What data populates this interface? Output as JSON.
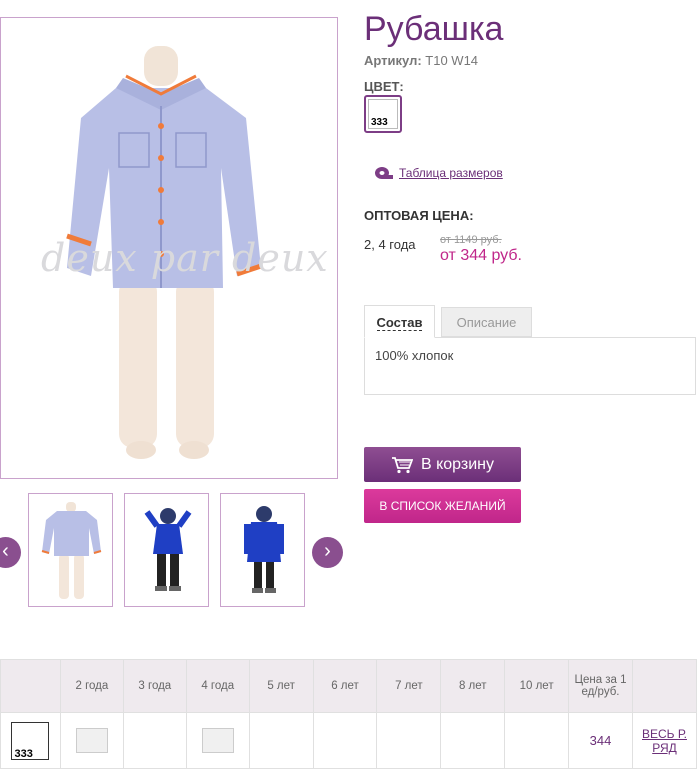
{
  "product": {
    "title": "Рубашка",
    "sku_label": "Артикул:",
    "sku_value": "T10 W14",
    "color_label": "ЦВЕТ:",
    "color_code": "333",
    "size_table_link": "Таблица размеров",
    "wholesale_label": "ОПТОВАЯ ЦЕНА:",
    "sizes": "2, 4 года",
    "old_price": "от 1149 руб.",
    "new_price": "от 344 руб."
  },
  "gallery": {
    "watermark": "deux par deux",
    "thumbnails": [
      "shirt",
      "blue-jacket-kid-1",
      "blue-jacket-kid-2"
    ]
  },
  "tabs": [
    {
      "label": "Состав",
      "active": true
    },
    {
      "label": "Описание",
      "active": false
    }
  ],
  "tab_content": "100% хлопок",
  "buttons": {
    "cart": "В корзину",
    "wishlist": "В СПИСОК ЖЕЛАНИЙ"
  },
  "grid": {
    "headers": [
      "",
      "2 года",
      "3 года",
      "4 года",
      "5 лет",
      "6 лет",
      "7 лет",
      "8 лет",
      "10 лет",
      "Цена за 1 ед/руб.",
      ""
    ],
    "row": {
      "color_code": "333",
      "available": [
        true,
        false,
        true,
        false,
        false,
        false,
        false,
        false
      ],
      "price": "344",
      "whole_row": "ВЕСЬ Р. РЯД"
    }
  },
  "colors": {
    "brand_purple": "#6b2f78",
    "accent_pink": "#c0268a",
    "border": "#c9a2cc"
  }
}
